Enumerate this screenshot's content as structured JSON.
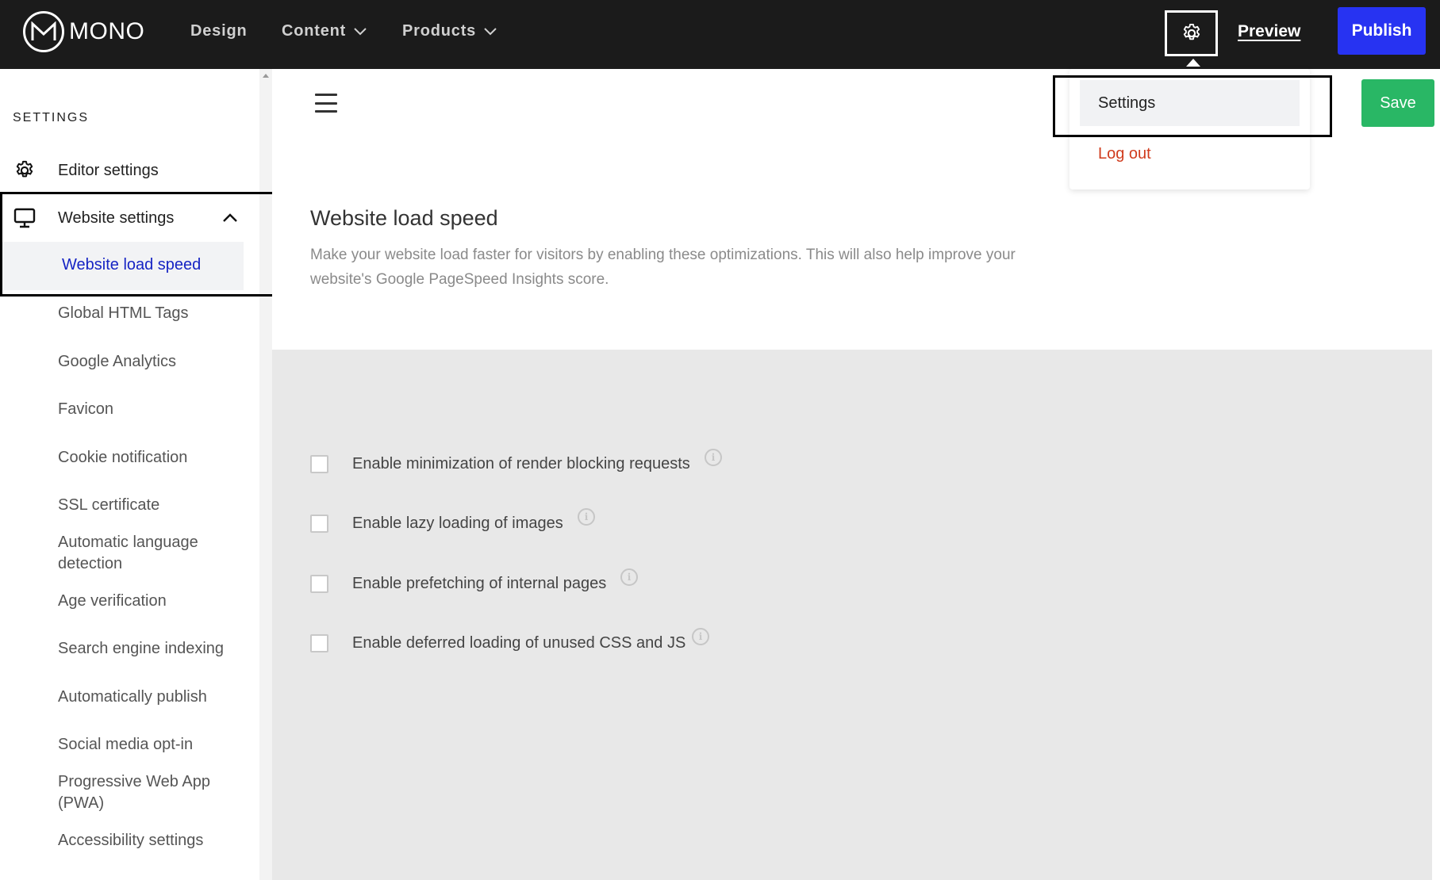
{
  "brand": {
    "name": "MONO",
    "mark": "M"
  },
  "nav": {
    "design": "Design",
    "content": "Content",
    "products": "Products"
  },
  "header_actions": {
    "preview": "Preview",
    "publish": "Publish"
  },
  "dropdown": {
    "settings": "Settings",
    "logout": "Log out"
  },
  "sidebar": {
    "heading": "SETTINGS",
    "editor_settings": "Editor settings",
    "website_settings": "Website settings",
    "active_item": "Website load speed",
    "items": [
      "Global HTML Tags",
      "Google Analytics",
      "Favicon",
      "Cookie notification",
      "SSL certificate",
      "Automatic language detection",
      "Age verification",
      "Search engine indexing",
      "Automatically publish",
      "Social media opt-in",
      "Progressive Web App (PWA)",
      "Accessibility settings"
    ]
  },
  "main": {
    "save": "Save",
    "title": "Website load speed",
    "description": "Make your website load faster for visitors by enabling these optimizations. This will also help improve your website's Google PageSpeed Insights score.",
    "options": [
      {
        "label": "Enable minimization of render blocking requests",
        "checked": false
      },
      {
        "label": "Enable lazy loading of images",
        "checked": false
      },
      {
        "label": "Enable prefetching of internal pages",
        "checked": false
      },
      {
        "label": "Enable deferred loading of unused CSS and JS",
        "checked": false
      }
    ]
  },
  "colors": {
    "topbar": "#1b1b1b",
    "publish": "#2733f2",
    "save": "#29b765",
    "active_link": "#1624c4",
    "logout": "#d03b1d"
  }
}
